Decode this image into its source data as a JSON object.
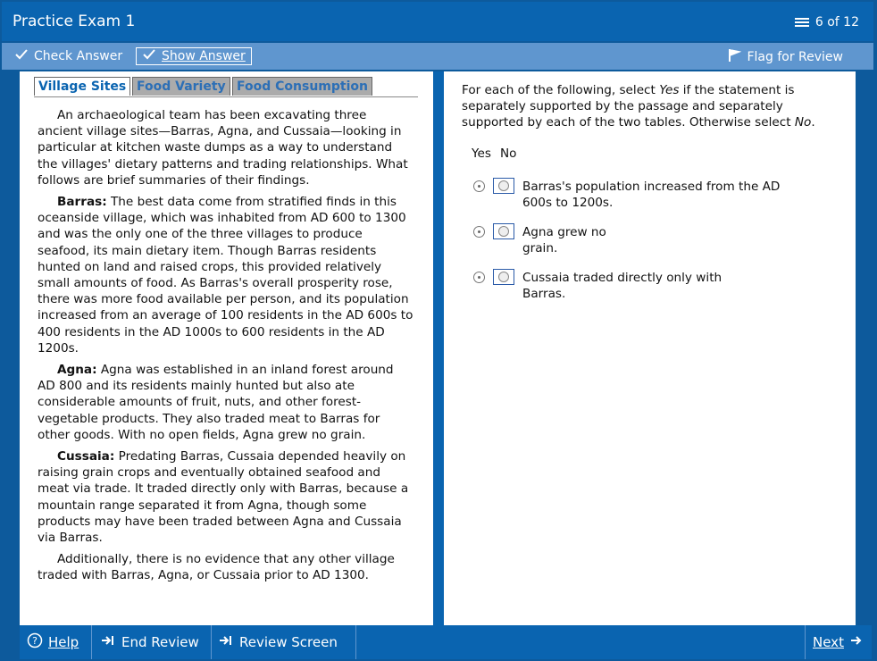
{
  "header": {
    "title": "Practice Exam 1",
    "counter": "6 of 12"
  },
  "toolbar": {
    "check_label": "Check Answer",
    "show_label": "Show Answer",
    "flag_label": "Flag for Review"
  },
  "tabs": [
    {
      "label": "Village Sites"
    },
    {
      "label": "Food Variety"
    },
    {
      "label": "Food Consumption"
    }
  ],
  "passage": {
    "intro": "An archaeological team has been excavating three ancient village sites—Barras, Agna, and Cussaia—looking in particular at kitchen waste dumps as a way to understand the villages' dietary patterns and trading relationships. What follows are brief summaries of their findings.",
    "barras_label": "Barras:",
    "barras_text": "The best data come from stratified finds in this oceanside village, which was inhabited from AD 600 to 1300 and was the only one of the three villages to produce seafood, its main dietary item. Though Barras residents hunted on land and raised crops, this provided relatively small amounts of food. As Barras's overall prosperity rose, there was more food available per person, and its population increased from an average of 100 residents in the AD 600s to 400 residents in the AD 1000s to 600 residents in the AD 1200s.",
    "agna_label": "Agna:",
    "agna_text": "Agna was established in an inland forest around AD 800 and its residents mainly hunted but also ate considerable amounts of fruit, nuts, and other forest-vegetable products. They also traded meat to Barras for other goods. With no open fields, Agna grew no grain.",
    "cussaia_label": "Cussaia:",
    "cussaia_text": "Predating Barras, Cussaia depended heavily on raising grain crops and eventually obtained seafood and meat via trade. It traded directly only with Barras, because a mountain range separated it from Agna, though some products may have been traded between Agna and Cussaia via Barras.",
    "closing": "Additionally, there is no evidence that any other village traded with Barras, Agna, or Cussaia prior to AD 1300."
  },
  "question": {
    "prompt_a": "For each of the following, select ",
    "prompt_yes": "Yes",
    "prompt_b": " if the statement is separately supported by the passage and separately supported by each of the two tables. Otherwise select ",
    "prompt_no": "No",
    "prompt_c": ".",
    "yes_header": "Yes",
    "no_header": "No",
    "statements": [
      {
        "text": "Barras's population increased from the AD 600s to 1200s."
      },
      {
        "text": "Agna grew no grain."
      },
      {
        "text": "Cussaia traded directly only with Barras."
      }
    ]
  },
  "footer": {
    "help": "Help",
    "end_review": "End Review",
    "review_screen": "Review Screen",
    "next": "Next"
  }
}
